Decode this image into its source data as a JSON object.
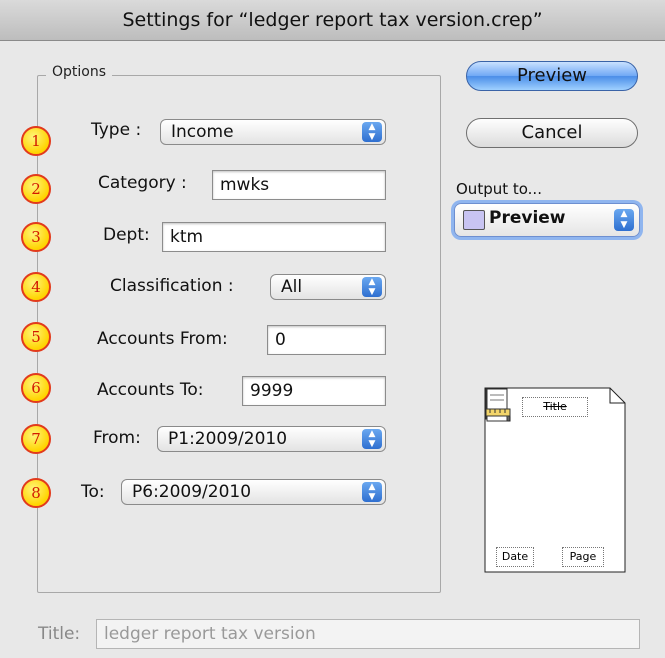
{
  "window": {
    "title": "Settings for “ledger report tax version.crep”"
  },
  "options": {
    "legend": "Options",
    "badges": [
      "1",
      "2",
      "3",
      "4",
      "5",
      "6",
      "7",
      "8"
    ],
    "type": {
      "label": "Type :",
      "value": "Income"
    },
    "category": {
      "label": "Category :",
      "value": "mwks"
    },
    "dept": {
      "label": "Dept:",
      "value": "ktm"
    },
    "classification": {
      "label": "Classification :",
      "value": "All"
    },
    "accounts_from": {
      "label": "Accounts From:",
      "value": "0"
    },
    "accounts_to": {
      "label": "Accounts To:",
      "value": "9999"
    },
    "from": {
      "label": "From:",
      "value": "P1:2009/2010"
    },
    "to": {
      "label": "To:",
      "value": "P6:2009/2010"
    }
  },
  "buttons": {
    "preview": "Preview",
    "cancel": "Cancel"
  },
  "output": {
    "label": "Output to...",
    "value": "Preview"
  },
  "page_preview": {
    "title": "Title",
    "date": "Date",
    "page": "Page"
  },
  "report_title": {
    "label": "Title:",
    "value": "ledger report tax version"
  },
  "colors": {
    "badge_fill": "#ffd400",
    "badge_border": "#e23a1c",
    "accent": "#4a8de8"
  },
  "icons": {
    "select_arrows": "up-down-arrows-icon",
    "output_doc": "document-icon"
  }
}
